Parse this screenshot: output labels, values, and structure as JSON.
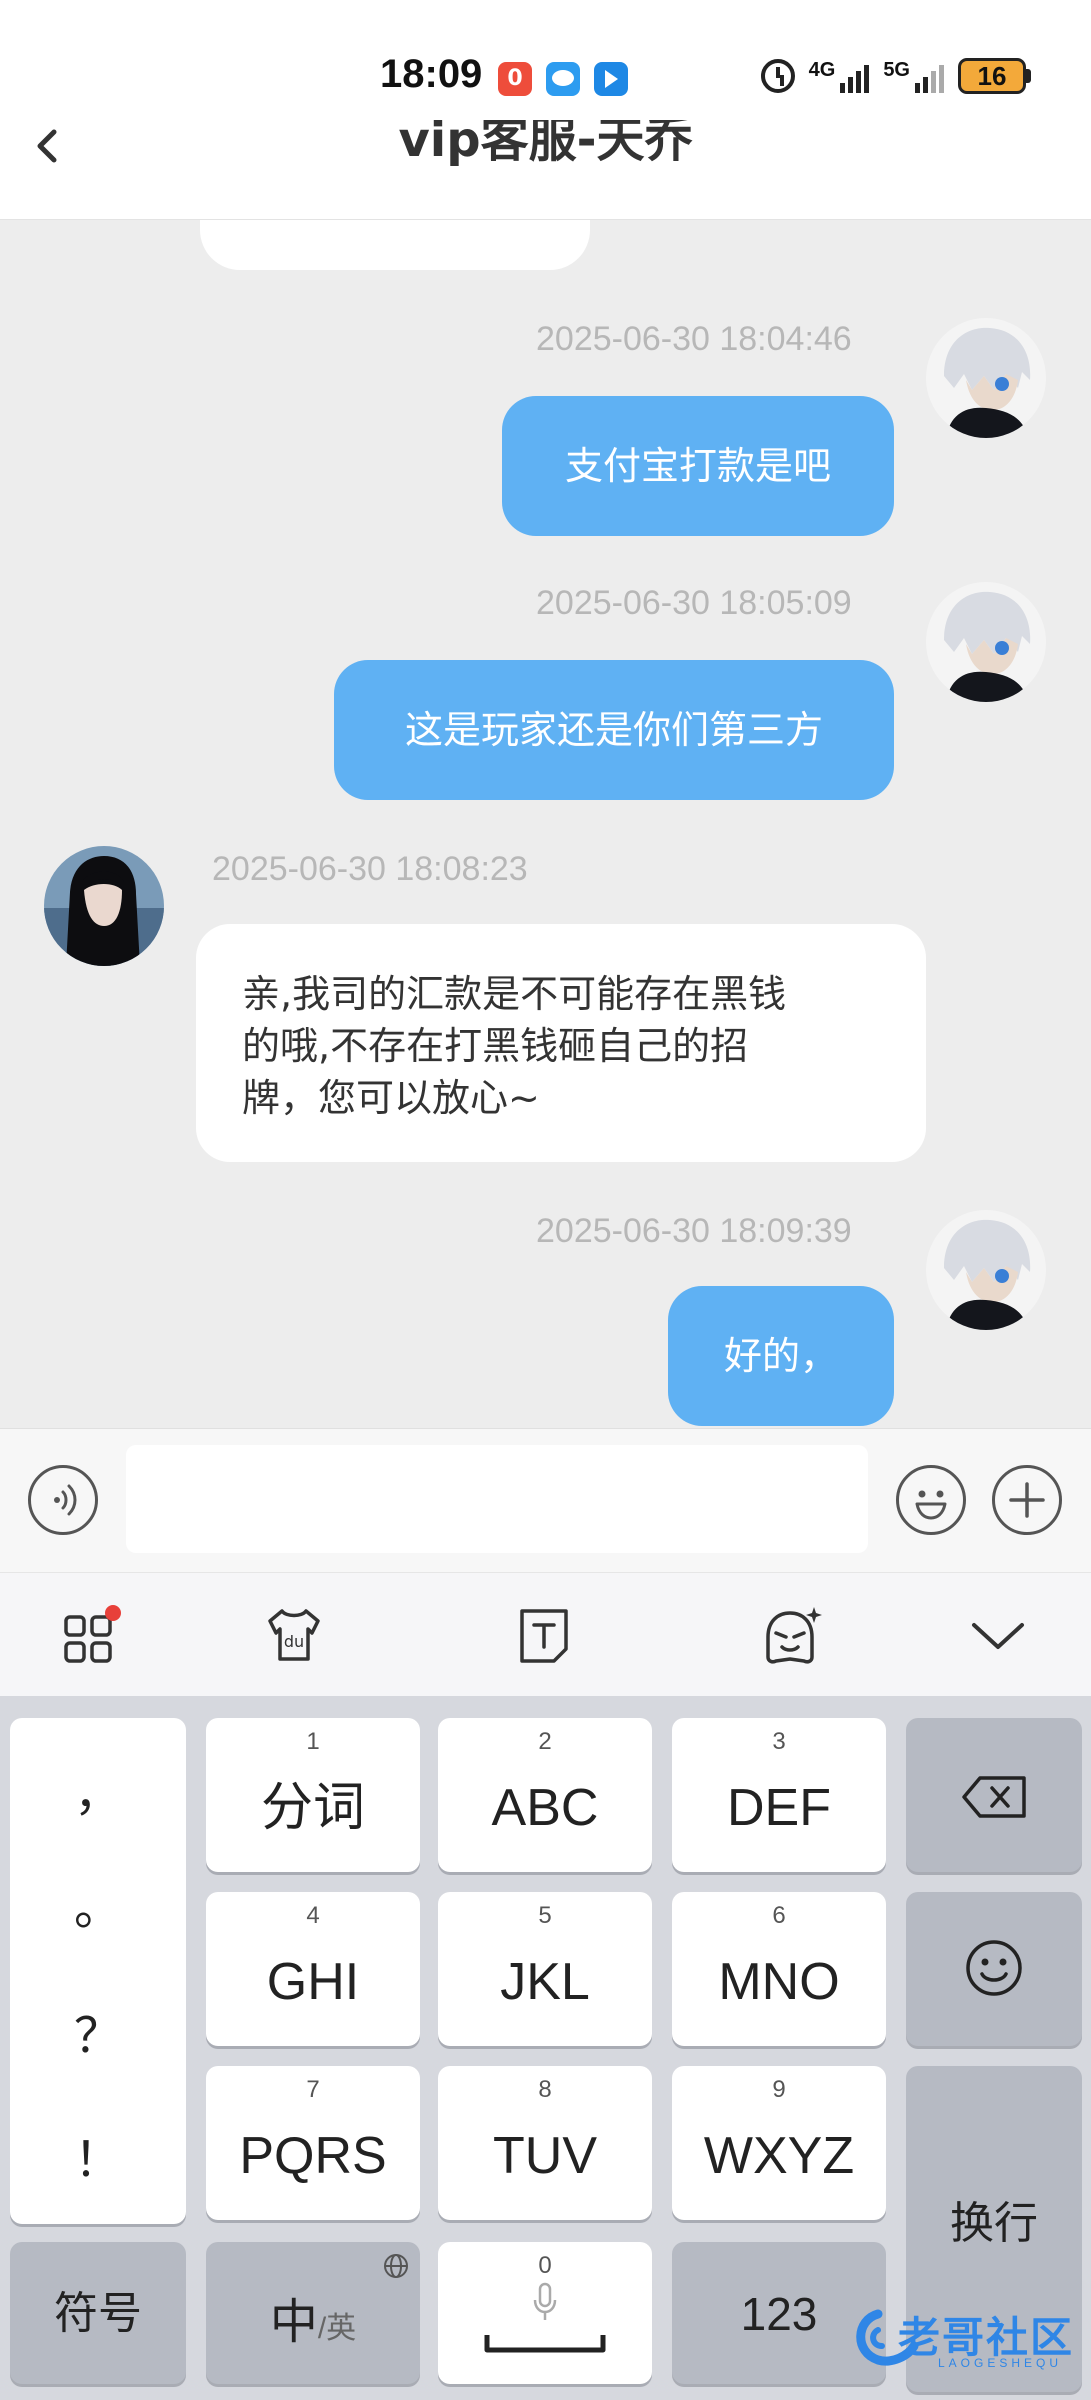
{
  "status_bar": {
    "time": "18:09",
    "notif_icons": [
      "app-badge-icon",
      "chat-bubble-icon",
      "app-arrow-icon"
    ],
    "network_1": "4G",
    "network_2": "5G",
    "battery": "16"
  },
  "header": {
    "title": "vip客服-天乔"
  },
  "messages": [
    {
      "side": "right",
      "timestamp": "2025-06-30 18:04:46",
      "text": "支付宝打款是吧"
    },
    {
      "side": "right",
      "timestamp": "2025-06-30 18:05:09",
      "text": "这是玩家还是你们第三方"
    },
    {
      "side": "left",
      "timestamp": "2025-06-30 18:08:23",
      "lines": [
        "亲,我司的汇款是不可能存在黑钱",
        "的哦,不存在打黑钱砸自己的招",
        "牌，您可以放心~"
      ]
    },
    {
      "side": "right",
      "timestamp": "2025-06-30 18:09:39",
      "text": "好的，"
    }
  ],
  "keyboard": {
    "punctuation": [
      "，",
      "。",
      "？",
      "！"
    ],
    "keys": [
      {
        "num": "1",
        "label": "分词"
      },
      {
        "num": "2",
        "label": "ABC"
      },
      {
        "num": "3",
        "label": "DEF"
      },
      {
        "num": "4",
        "label": "GHI"
      },
      {
        "num": "5",
        "label": "JKL"
      },
      {
        "num": "6",
        "label": "MNO"
      },
      {
        "num": "7",
        "label": "PQRS"
      },
      {
        "num": "8",
        "label": "TUV"
      },
      {
        "num": "9",
        "label": "WXYZ"
      }
    ],
    "symbols_label": "符号",
    "lang_main": "中",
    "lang_alt": "/英",
    "space_num": "0",
    "numbers_label": "123",
    "enter_label": "换行"
  },
  "watermark": {
    "text": "老哥社区",
    "subtext": "LAOGESHEQU"
  },
  "colors": {
    "outgoing_bubble": "#5fb1f3",
    "incoming_bubble": "#ffffff",
    "chat_background": "#ededed",
    "keyboard_background": "#d6d8de"
  }
}
